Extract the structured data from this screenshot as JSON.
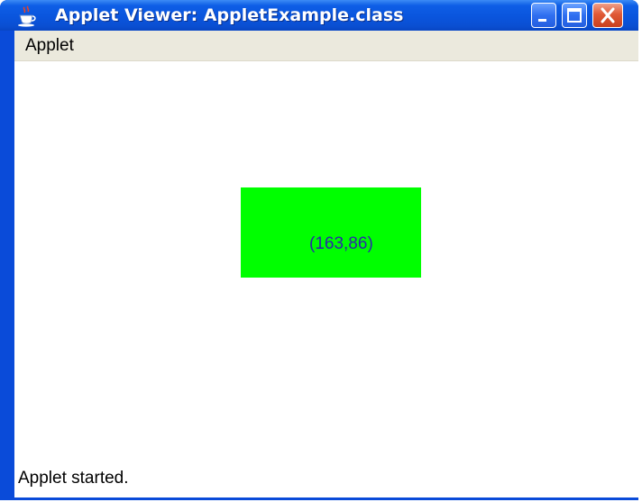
{
  "window": {
    "title": "Applet Viewer: AppletExample.class",
    "icon": "java-cup-icon",
    "controls": [
      "minimize-icon",
      "maximize-icon",
      "close-icon"
    ]
  },
  "menu": {
    "items": [
      {
        "label": "Applet"
      }
    ]
  },
  "applet": {
    "coordinate_text": "(163,86)",
    "rect_color": "#00ff00",
    "text_color": "#2a2aa8"
  },
  "status": {
    "text": "Applet started."
  },
  "colors": {
    "titlebar": "#0a55dd",
    "menubar": "#ebe9dd",
    "close_button": "#e05a36"
  }
}
